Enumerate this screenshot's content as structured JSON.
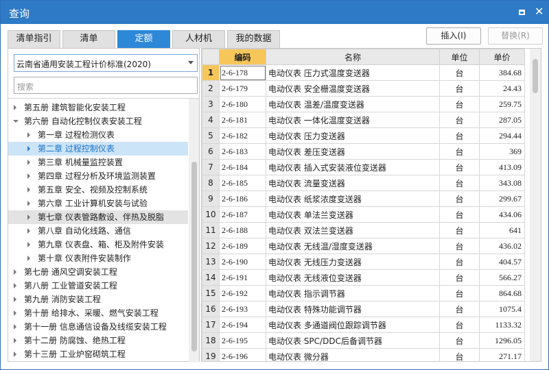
{
  "window": {
    "title": "查询"
  },
  "tabs": [
    {
      "label": "清单指引",
      "active": false
    },
    {
      "label": "清单",
      "active": false
    },
    {
      "label": "定额",
      "active": true
    },
    {
      "label": "人材机",
      "active": false
    },
    {
      "label": "我的数据",
      "active": false
    }
  ],
  "actions": {
    "insert": "插入(I)",
    "replace": "替换(R)"
  },
  "left": {
    "dropdown_value": "云南省通用安装工程计价标准(2020)",
    "search_placeholder": "搜索"
  },
  "tree": [
    {
      "label": "第五册 建筑智能化安装工程",
      "level": 0,
      "expanded": false
    },
    {
      "label": "第六册 自动化控制仪表安装工程",
      "level": 0,
      "expanded": true
    },
    {
      "label": "第一章 过程检测仪表",
      "level": 1,
      "expanded": false
    },
    {
      "label": "第二章 过程控制仪表",
      "level": 1,
      "expanded": false,
      "selected": true
    },
    {
      "label": "第三章 机械量监控装置",
      "level": 1,
      "expanded": false
    },
    {
      "label": "第四章 过程分析及环境监测装置",
      "level": 1,
      "expanded": false
    },
    {
      "label": "第五章 安全、视频及控制系统",
      "level": 1,
      "expanded": false
    },
    {
      "label": "第六章 工业计算机安装与试验",
      "level": 1,
      "expanded": false
    },
    {
      "label": "第七章 仪表管路敷设、伴热及脱脂",
      "level": 1,
      "expanded": false,
      "hover": true
    },
    {
      "label": "第八章 自动化线路、通信",
      "level": 1,
      "expanded": false
    },
    {
      "label": "第九章 仪表盘、箱、柜及附件安装",
      "level": 1,
      "expanded": false
    },
    {
      "label": "第十章 仪表附件安装制作",
      "level": 1,
      "expanded": false
    },
    {
      "label": "第七册 通风空调安装工程",
      "level": 0,
      "expanded": false
    },
    {
      "label": "第八册 工业管道安装工程",
      "level": 0,
      "expanded": false
    },
    {
      "label": "第九册 消防安装工程",
      "level": 0,
      "expanded": false
    },
    {
      "label": "第十册 给排水、采暖、燃气安装工程",
      "level": 0,
      "expanded": false
    },
    {
      "label": "第十一册 信息通信设备及线缆安装工程",
      "level": 0,
      "expanded": false
    },
    {
      "label": "第十二册 防腐蚀、绝热工程",
      "level": 0,
      "expanded": false
    },
    {
      "label": "第十三册 工业炉窑砌筑工程",
      "level": 0,
      "expanded": false
    }
  ],
  "table": {
    "columns": [
      "",
      "编码",
      "名称",
      "单位",
      "单价"
    ],
    "rows": [
      [
        "1",
        "2-6-178",
        "电动仪表 压力式温度变送器",
        "台",
        "384.68"
      ],
      [
        "2",
        "2-6-179",
        "电动仪表 安全栅温度变送器",
        "台",
        "24.43"
      ],
      [
        "3",
        "2-6-180",
        "电动仪表 温差/温度变送器",
        "台",
        "259.75"
      ],
      [
        "4",
        "2-6-181",
        "电动仪表 一体化温度变送器",
        "台",
        "287.05"
      ],
      [
        "5",
        "2-6-182",
        "电动仪表 压力变送器",
        "台",
        "294.44"
      ],
      [
        "6",
        "2-6-183",
        "电动仪表 差压变送器",
        "台",
        "369"
      ],
      [
        "7",
        "2-6-184",
        "电动仪表 插入式安装液位变送器",
        "台",
        "413.09"
      ],
      [
        "8",
        "2-6-185",
        "电动仪表 流量变送器",
        "台",
        "343.08"
      ],
      [
        "9",
        "2-6-186",
        "电动仪表 纸浆浓度变送器",
        "台",
        "299.67"
      ],
      [
        "10",
        "2-6-187",
        "电动仪表 单法兰变送器",
        "台",
        "434.06"
      ],
      [
        "11",
        "2-6-188",
        "电动仪表 双法兰变送器",
        "台",
        "641"
      ],
      [
        "12",
        "2-6-189",
        "电动仪表 无线温/湿度变送器",
        "台",
        "436.02"
      ],
      [
        "13",
        "2-6-190",
        "电动仪表 无线压力变送器",
        "台",
        "404.57"
      ],
      [
        "14",
        "2-6-191",
        "电动仪表 无线液位变送器",
        "台",
        "566.27"
      ],
      [
        "15",
        "2-6-192",
        "电动仪表 指示调节器",
        "台",
        "864.68"
      ],
      [
        "16",
        "2-6-193",
        "电动仪表 特殊功能调节器",
        "台",
        "1075.4"
      ],
      [
        "17",
        "2-6-194",
        "电动仪表 多通道阀位跟踪调节器",
        "台",
        "1133.32"
      ],
      [
        "18",
        "2-6-195",
        "电动仪表 SPC/DDC后备调节器",
        "台",
        "1296.05"
      ],
      [
        "19",
        "2-6-196",
        "电动仪表 微分器",
        "台",
        "271.17"
      ]
    ]
  }
}
